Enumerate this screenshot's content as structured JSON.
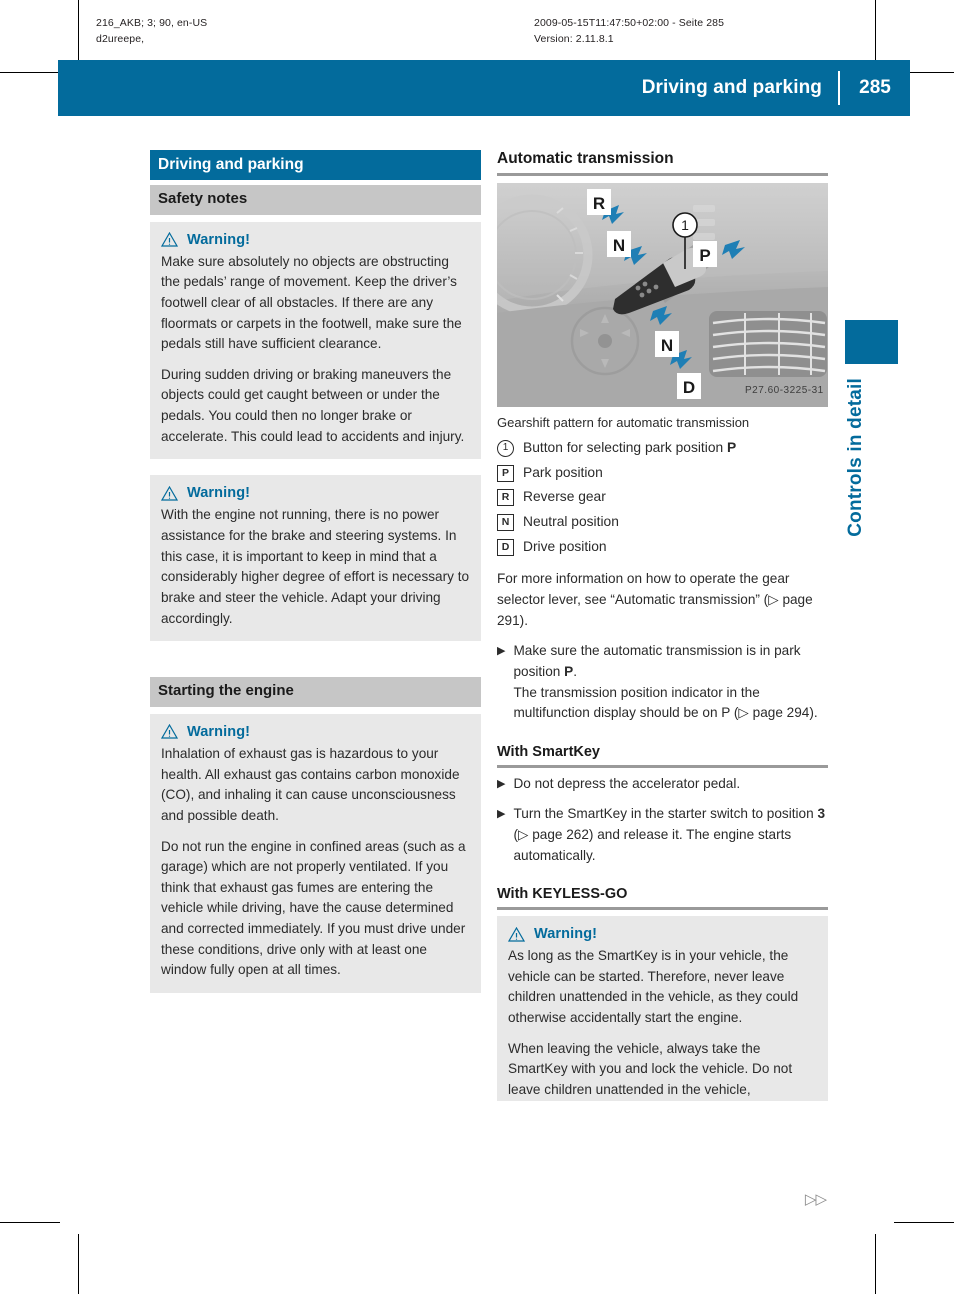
{
  "meta": {
    "left_line1": "216_AKB; 3; 90, en-US",
    "left_line2": "d2ureepe,",
    "right_line1": "2009-05-15T11:47:50+02:00 - Seite 285",
    "right_line2": "Version: 2.11.8.1"
  },
  "header": {
    "title": "Driving and parking",
    "page_number": "285"
  },
  "thumb_tab": {
    "label": "Controls in detail"
  },
  "colors": {
    "brand_blue": "#036b9c",
    "section_gray": "#c6c6c6",
    "warning_bg": "#e8e8e8",
    "rule_gray": "#9a9a9a"
  },
  "left_column": {
    "chapter_heading": "Driving and parking",
    "section_heading": "Safety notes",
    "warning1": {
      "title": "Warning!",
      "paragraphs": [
        "Make sure absolutely no objects are obstructing the pedals’ range of movement. Keep the driver’s footwell clear of all obstacles. If there are any floormats or carpets in the footwell, make sure the pedals still have sufficient clearance.",
        "During sudden driving or braking maneuvers the objects could get caught between or under the pedals. You could then no longer brake or accelerate. This could lead to accidents and injury."
      ]
    },
    "warning2": {
      "title": "Warning!",
      "paragraphs": [
        "With the engine not running, there is no power assistance for the brake and steering systems. In this case, it is important to keep in mind that a considerably higher degree of effort is necessary to brake and steer the vehicle. Adapt your driving accordingly."
      ]
    },
    "section_heading2": "Starting the engine",
    "warning3": {
      "title": "Warning!",
      "paragraphs": [
        "Inhalation of exhaust gas is hazardous to your health. All exhaust gas contains carbon monoxide (CO), and inhaling it can cause unconsciousness and possible death.",
        "Do not run the engine in confined areas (such as a garage) which are not properly ventilated. If you think that exhaust gas fumes are entering the vehicle while driving, have the cause determined and corrected immediately. If you must drive under these conditions, drive only with at least one window fully open at all times."
      ]
    }
  },
  "right_column": {
    "major_heading": "Automatic transmission",
    "figure": {
      "caption": "Gearshift pattern for automatic transmission",
      "part_number": "P27.60-3225-31",
      "callouts": [
        "R",
        "N",
        "1",
        "P",
        "N",
        "D"
      ]
    },
    "legend": [
      {
        "marker": "1",
        "marker_type": "circle",
        "text": "Button for selecting park position ",
        "bold_suffix": "P"
      },
      {
        "marker": "P",
        "marker_type": "box",
        "text": "Park position",
        "bold_suffix": ""
      },
      {
        "marker": "R",
        "marker_type": "box",
        "text": "Reverse gear",
        "bold_suffix": ""
      },
      {
        "marker": "N",
        "marker_type": "box",
        "text": "Neutral position",
        "bold_suffix": ""
      },
      {
        "marker": "D",
        "marker_type": "box",
        "text": "Drive position",
        "bold_suffix": ""
      }
    ],
    "intro_paragraph": "For more information on how to operate the gear selector lever, see “Automatic transmission” (▷ page 291).",
    "step1_line1": "Make sure the automatic transmission is in park position ",
    "step1_bold": "P",
    "step1_line2": ".",
    "step1_extra": "The transmission position indicator in the multifunction display should be on P (▷ page 294).",
    "smartkey_heading": "With SmartKey",
    "smartkey_steps": [
      "Do not depress the accelerator pedal."
    ],
    "smartkey_step2_pre": "Turn the SmartKey in the starter switch to position ",
    "smartkey_step2_bold": "3",
    "smartkey_step2_post": " (▷ page 262) and release it. The engine starts automatically.",
    "keyless_heading": "With KEYLESS-GO",
    "warning4": {
      "title": "Warning!",
      "paragraphs": [
        "As long as the SmartKey is in your vehicle, the vehicle can be started. Therefore, never leave children unattended in the vehicle, as they could otherwise accidentally start the engine.",
        "When leaving the vehicle, always take the SmartKey with you and lock the vehicle. Do not leave children unattended in the vehicle,"
      ]
    }
  },
  "footer": {
    "continuation_marker": "▷▷"
  }
}
